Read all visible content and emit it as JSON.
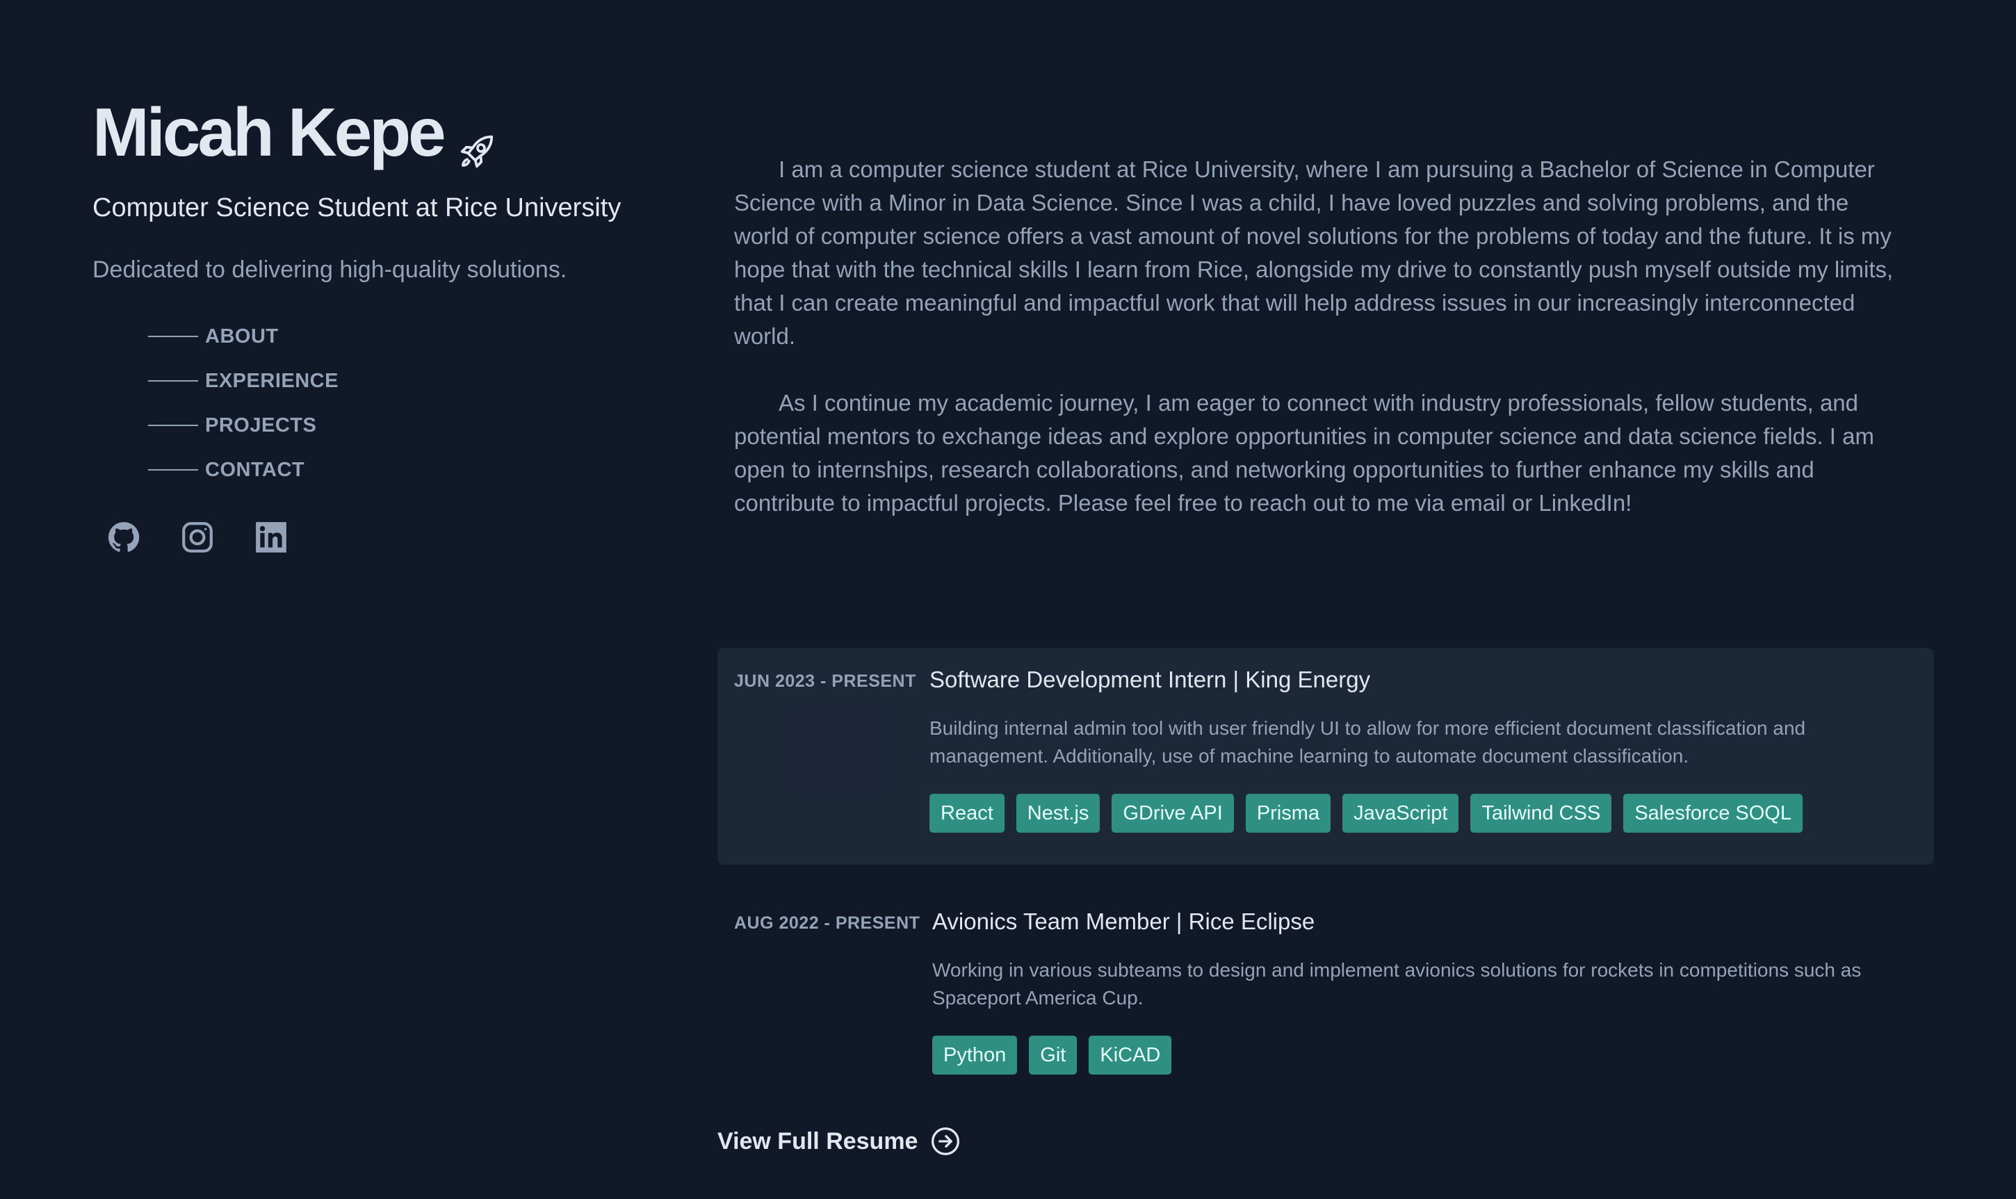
{
  "header": {
    "name": "Micah Kepe",
    "role": "Computer Science Student at Rice University",
    "tagline": "Dedicated to delivering high-quality solutions."
  },
  "nav": {
    "items": [
      {
        "label": "ABOUT"
      },
      {
        "label": "EXPERIENCE"
      },
      {
        "label": "PROJECTS"
      },
      {
        "label": "CONTACT"
      }
    ]
  },
  "socials": [
    "github-icon",
    "instagram-icon",
    "linkedin-icon"
  ],
  "about": {
    "p1": "I am a computer science student at Rice University, where I am pursuing a Bachelor of Science in Computer Science with a Minor in Data Science. Since I was a child, I have loved puzzles and solving problems, and the world of computer science offers a vast amount of novel solutions for the problems of today and the future. It is my hope that with the technical skills I learn from Rice, alongside my drive to constantly push myself outside my limits, that I can create meaningful and impactful work that will help address issues in our increasingly interconnected world.",
    "p2": "As I continue my academic journey, I am eager to connect with industry professionals, fellow students, and potential mentors to exchange ideas and explore opportunities in computer science and data science fields. I am open to internships, research collaborations, and networking opportunities to further enhance my skills and contribute to impactful projects. Please feel free to reach out to me via email or LinkedIn!"
  },
  "experience": [
    {
      "date": "JUN 2023 - PRESENT",
      "title": "Software Development Intern | King Energy",
      "desc": "Building internal admin tool with user friendly UI to allow for more efficient document classification and management. Additionally, use of machine learning to automate document classification.",
      "tags": [
        "React",
        "Nest.js",
        "GDrive API",
        "Prisma",
        "JavaScript",
        "Tailwind CSS",
        "Salesforce SOQL"
      ]
    },
    {
      "date": "AUG 2022 - PRESENT",
      "title": "Avionics Team Member | Rice Eclipse",
      "desc": "Working in various subteams to design and implement avionics solutions for rockets in competitions such as Spaceport America Cup.",
      "tags": [
        "Python",
        "Git",
        "KiCAD"
      ]
    }
  ],
  "resume": {
    "label": "View Full Resume"
  },
  "colors": {
    "background": "#111827",
    "card": "#1e293b",
    "tag": "#2f8f83",
    "text": "#94a3b8",
    "heading": "#e2e8f0"
  }
}
